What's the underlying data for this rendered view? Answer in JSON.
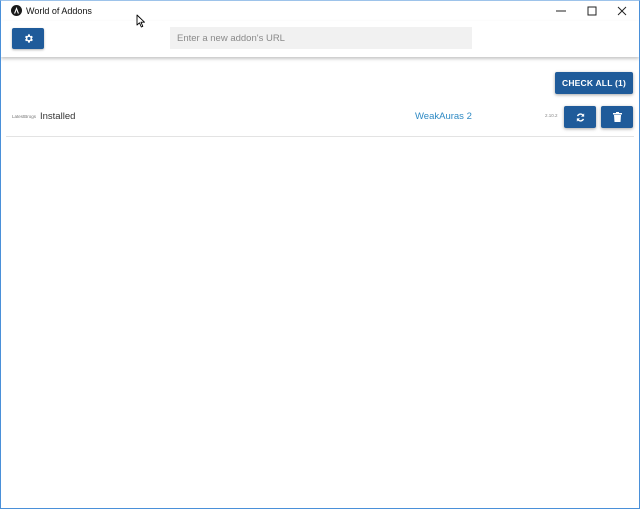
{
  "window": {
    "title": "World of Addons",
    "app_icon": "wow-logo-icon",
    "controls": [
      "minimize-icon",
      "maximize-icon",
      "close-icon"
    ]
  },
  "toolbar": {
    "settings_icon": "gear-icon",
    "url_input": {
      "placeholder": "Enter a new addon's URL",
      "value": ""
    }
  },
  "main": {
    "check_all_label": "CHECK ALL (1)",
    "addons": [
      {
        "provider": "LatestBrogs",
        "status": "Installed",
        "name": "WeakAuras 2",
        "version": "2.10.2",
        "update_icon": "refresh-icon",
        "delete_icon": "trash-icon"
      }
    ]
  },
  "colors": {
    "accent": "#1f5b9a",
    "link": "#2f8ac4",
    "input_bg": "#f1f1f1",
    "window_border": "#4a90d9"
  }
}
